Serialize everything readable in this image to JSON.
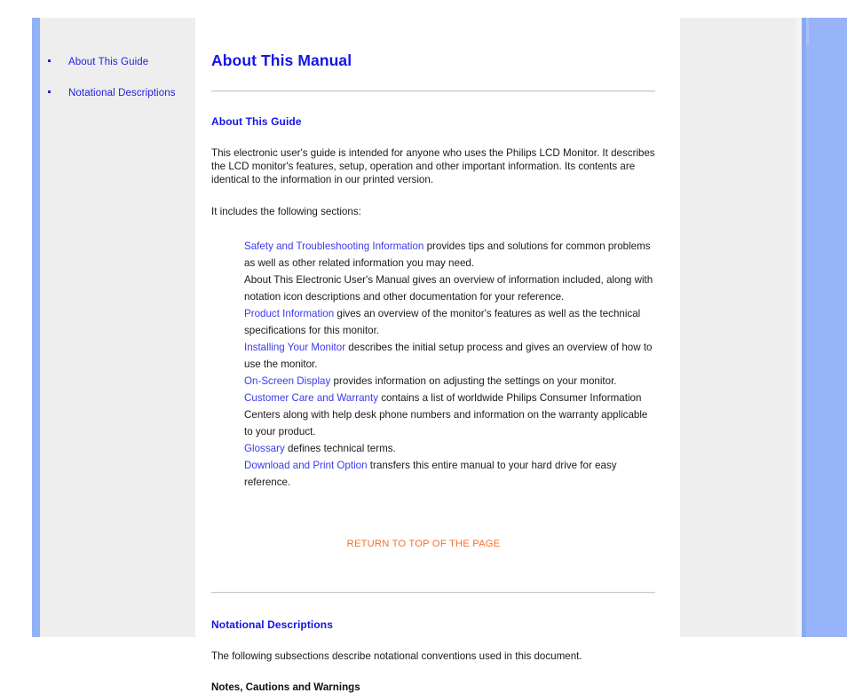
{
  "sidebar": {
    "items": [
      {
        "label": "About This Guide",
        "bullet_icon": "bullet-icon"
      },
      {
        "label": "Notational Descriptions",
        "bullet_icon": "bullet-icon"
      }
    ]
  },
  "main": {
    "page_title": "About This Manual",
    "section_about": {
      "title": "About This Guide",
      "intro_paragraph": "This electronic user's guide is intended for anyone who uses the Philips LCD Monitor. It describes the LCD monitor's features, setup, operation and other important information. Its contents are identical to the information in our printed version.",
      "includes_label": "It includes the following sections:",
      "entries": [
        {
          "link": "Safety and Troubleshooting Information",
          "is_link": true,
          "text": " provides tips and solutions for common problems as well as other related information you may need."
        },
        {
          "link": "About This Electronic User's Manual",
          "is_link": false,
          "text": " gives an overview of information included, along with notation icon descriptions and other documentation for your reference."
        },
        {
          "link": "Product Information",
          "is_link": true,
          "text": " gives an overview of the monitor's features as well as the technical specifications for this monitor."
        },
        {
          "link": "Installing Your Monitor",
          "is_link": true,
          "text": " describes the initial setup process and gives an overview of how to use the monitor."
        },
        {
          "link": "On-Screen Display",
          "is_link": true,
          "text": " provides information on adjusting the settings on your monitor."
        },
        {
          "link": "Customer Care and Warranty",
          "is_link": true,
          "text": " contains a list of worldwide Philips Consumer Information Centers along with help desk phone numbers and information on the warranty applicable to your product."
        },
        {
          "link": "Glossary",
          "is_link": true,
          "text": " defines technical terms."
        },
        {
          "link": "Download and Print Option",
          "is_link": true,
          "text": " transfers this entire manual to your hard drive for easy reference."
        }
      ],
      "return_to_top": "RETURN TO TOP OF THE PAGE"
    },
    "section_notational": {
      "title": "Notational Descriptions",
      "paragraph": "The following subsections describe notational conventions used in this document.",
      "subsection_title": "Notes, Cautions and Warnings"
    }
  },
  "colors": {
    "link_blue": "#2222e0",
    "heading_blue": "#1414e6",
    "entry_link_blue": "#3a3aee",
    "return_orange": "#f4702a",
    "panel_gray": "#eeeeee",
    "accent_blue": "#92b1f7",
    "body_text": "#1a1a1a"
  }
}
